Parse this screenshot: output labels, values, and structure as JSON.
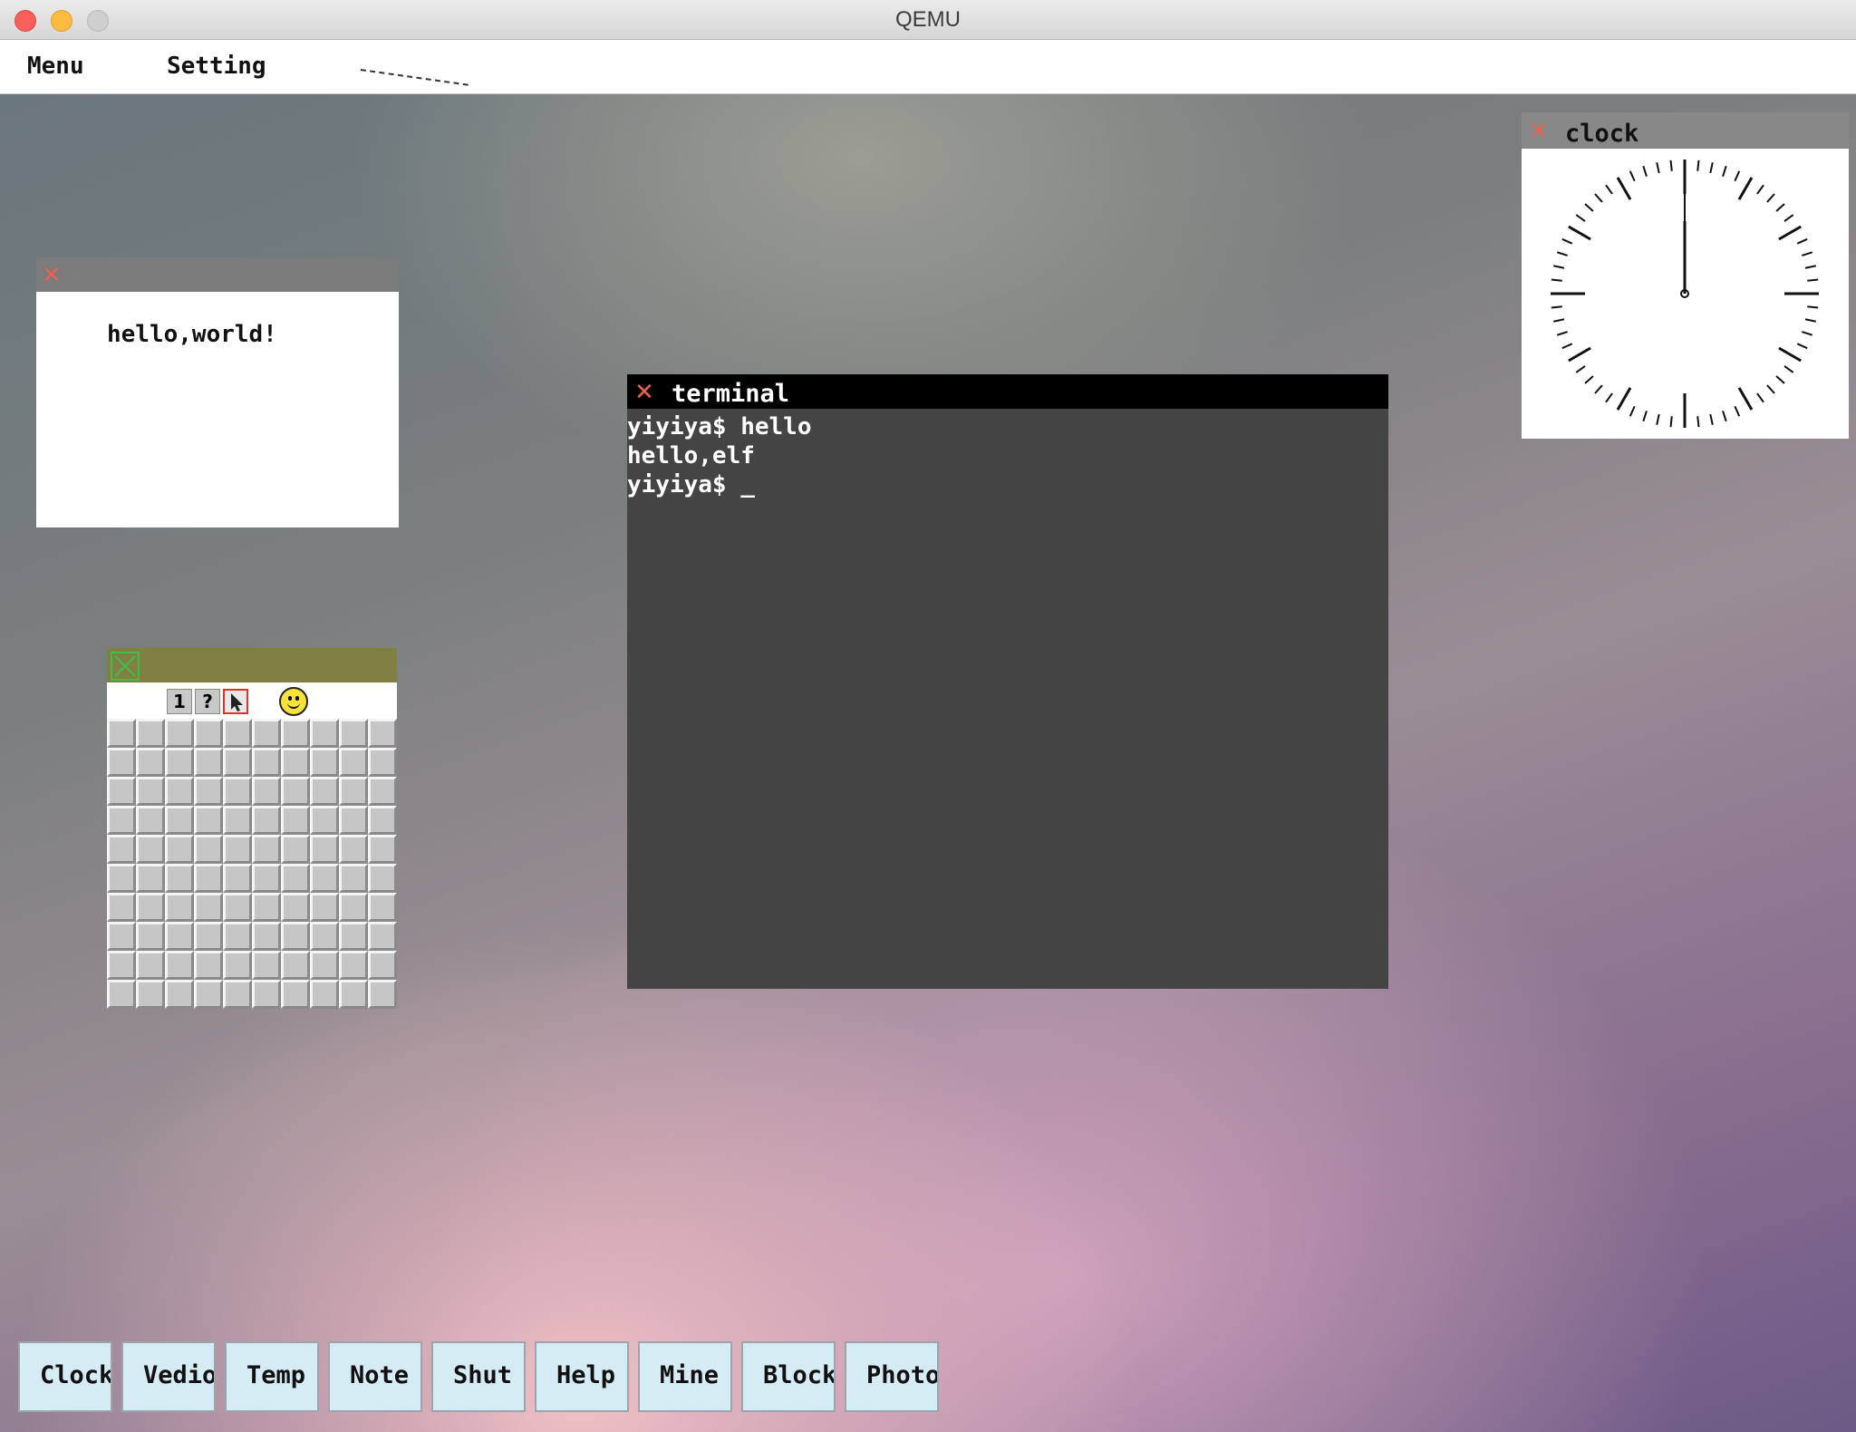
{
  "window": {
    "title": "QEMU",
    "controls": [
      "close-button",
      "minimize-button",
      "zoom-button"
    ]
  },
  "menubar": {
    "items": [
      {
        "label": "Menu"
      },
      {
        "label": "Setting"
      }
    ]
  },
  "hello_window": {
    "close_icon": "close-icon",
    "text": "hello,world!"
  },
  "minesweeper": {
    "close_icon": "close-icon",
    "tools": [
      {
        "name": "flag-tool",
        "glyph": "1"
      },
      {
        "name": "question-tool",
        "glyph": "?"
      },
      {
        "name": "pointer-tool",
        "glyph": "pointer",
        "selected": true
      }
    ],
    "face": "smiley-icon",
    "rows": 10,
    "cols": 10
  },
  "terminal": {
    "title": "terminal",
    "lines": [
      "yiyiya$ hello",
      "hello,elf",
      "yiyiya$ _"
    ]
  },
  "clock": {
    "title": "clock",
    "time": {
      "hour": 12,
      "minute": 0
    }
  },
  "taskbar": {
    "buttons": [
      {
        "label": "Clock"
      },
      {
        "label": "Vedio"
      },
      {
        "label": "Temp"
      },
      {
        "label": "Note"
      },
      {
        "label": "Shut"
      },
      {
        "label": "Help"
      },
      {
        "label": "Mine"
      },
      {
        "label": "Block"
      },
      {
        "label": "Photo"
      }
    ]
  },
  "colors": {
    "close_x": "#e46454",
    "minesweeper_titlebar": "#808044",
    "terminal_bg": "#444444",
    "taskbar_button": "#d6ecf4"
  }
}
